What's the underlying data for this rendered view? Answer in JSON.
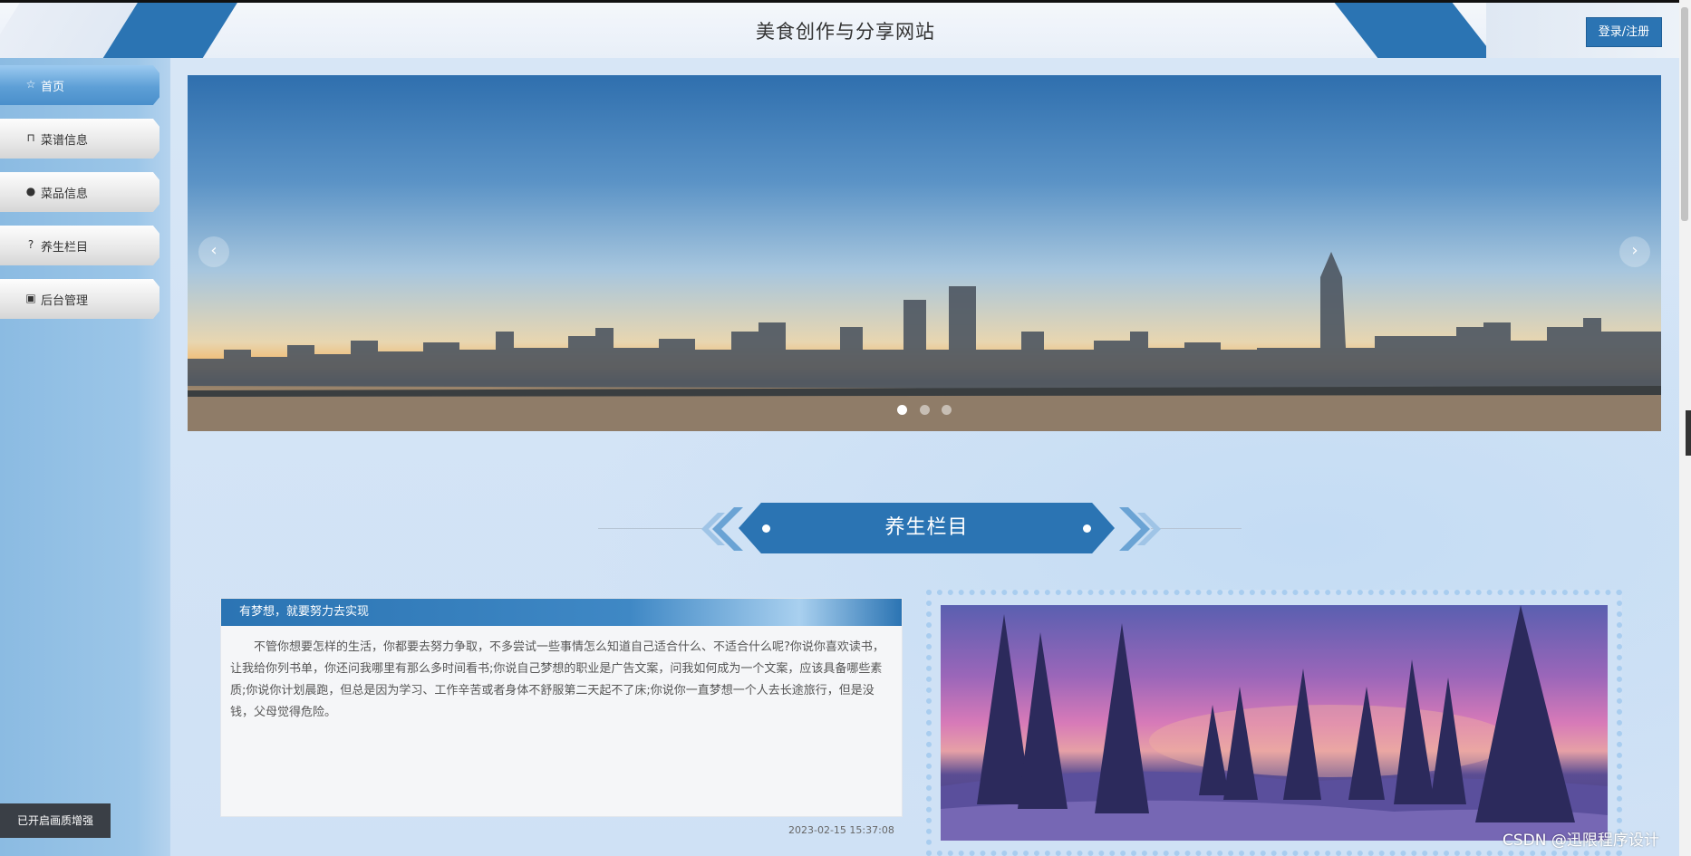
{
  "header": {
    "title": "美食创作与分享网站",
    "login_label": "登录/注册"
  },
  "sidebar": {
    "items": [
      {
        "label": "首页",
        "icon": "star-icon"
      },
      {
        "label": "菜谱信息",
        "icon": "bag-icon"
      },
      {
        "label": "菜品信息",
        "icon": "info-icon"
      },
      {
        "label": "养生栏目",
        "icon": "question-icon"
      },
      {
        "label": "后台管理",
        "icon": "calendar-icon"
      }
    ],
    "active_index": 0
  },
  "carousel": {
    "prev_label": "‹",
    "next_label": "›",
    "slide_count": 3,
    "active_slide": 1
  },
  "section": {
    "title": "养生栏目"
  },
  "article": {
    "heading": "有梦想，就要努力去实现",
    "body": "不管你想要怎样的生活，你都要去努力争取，不多尝试一些事情怎么知道自己适合什么、不适合什么呢?你说你喜欢读书，让我给你列书单，你还问我哪里有那么多时间看书;你说自己梦想的职业是广告文案，问我如何成为一个文案，应该具备哪些素质;你说你计划晨跑，但总是因为学习、工作辛苦或者身体不舒服第二天起不了床;你说你一直梦想一个人去长途旅行，但是没钱，父母觉得危险。",
    "date": "2023-02-15 15:37:08"
  },
  "overlay": {
    "toast": "已开启画质增强",
    "watermark": "CSDN @迅限程序设计"
  },
  "colors": {
    "accent": "#2b74b3",
    "sidebar_bg": "#9cc6e8",
    "page_bg": "#cfe0f4"
  }
}
